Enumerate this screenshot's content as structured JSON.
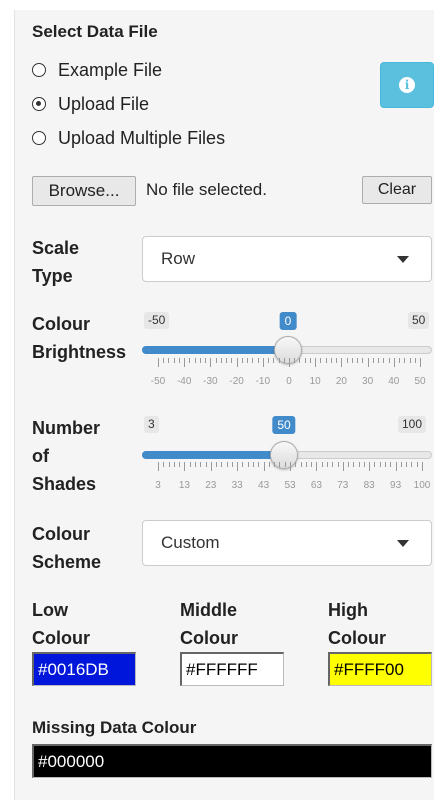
{
  "data_file": {
    "title": "Select Data File",
    "options": [
      {
        "label": "Example File",
        "checked": false
      },
      {
        "label": "Upload File",
        "checked": true
      },
      {
        "label": "Upload Multiple Files",
        "checked": false
      }
    ],
    "info_icon": "info-icon"
  },
  "file_input": {
    "browse_label": "Browse...",
    "status": "No file selected.",
    "clear_label": "Clear"
  },
  "scale_type": {
    "label_line1": "Scale",
    "label_line2": "Type",
    "selected": "Row"
  },
  "brightness": {
    "label_line1": "Colour",
    "label_line2": "Brightness",
    "min": "-50",
    "max": "50",
    "value": "0",
    "ticks": [
      "-50",
      "-40",
      "-30",
      "-20",
      "-10",
      "0",
      "10",
      "20",
      "30",
      "40",
      "50"
    ]
  },
  "shades": {
    "label_line1": "Number",
    "label_line2": "of",
    "label_line3": "Shades",
    "min": "3",
    "max": "100",
    "value": "50",
    "ticks": [
      "3",
      "13",
      "23",
      "33",
      "43",
      "53",
      "63",
      "73",
      "83",
      "93",
      "100"
    ]
  },
  "colour_scheme": {
    "label_line1": "Colour",
    "label_line2": "Scheme",
    "selected": "Custom"
  },
  "colours": {
    "low_line1": "Low",
    "low_line2": "Colour",
    "low_value": "#0016DB",
    "low_bg": "#0016DB",
    "low_text": "#FFFFFF",
    "middle_line1": "Middle",
    "middle_line2": "Colour",
    "middle_value": "#FFFFFF",
    "middle_bg": "#FFFFFF",
    "middle_text": "#000000",
    "high_line1": "High",
    "high_line2": "Colour",
    "high_value": "#FFFF00",
    "high_bg": "#FFFF00",
    "high_text": "#000000"
  },
  "missing": {
    "label": "Missing Data Colour",
    "value": "#000000",
    "bg": "#000000",
    "text": "#FFFFFF"
  },
  "accent": "#428bca",
  "info_color": "#5bc0de"
}
